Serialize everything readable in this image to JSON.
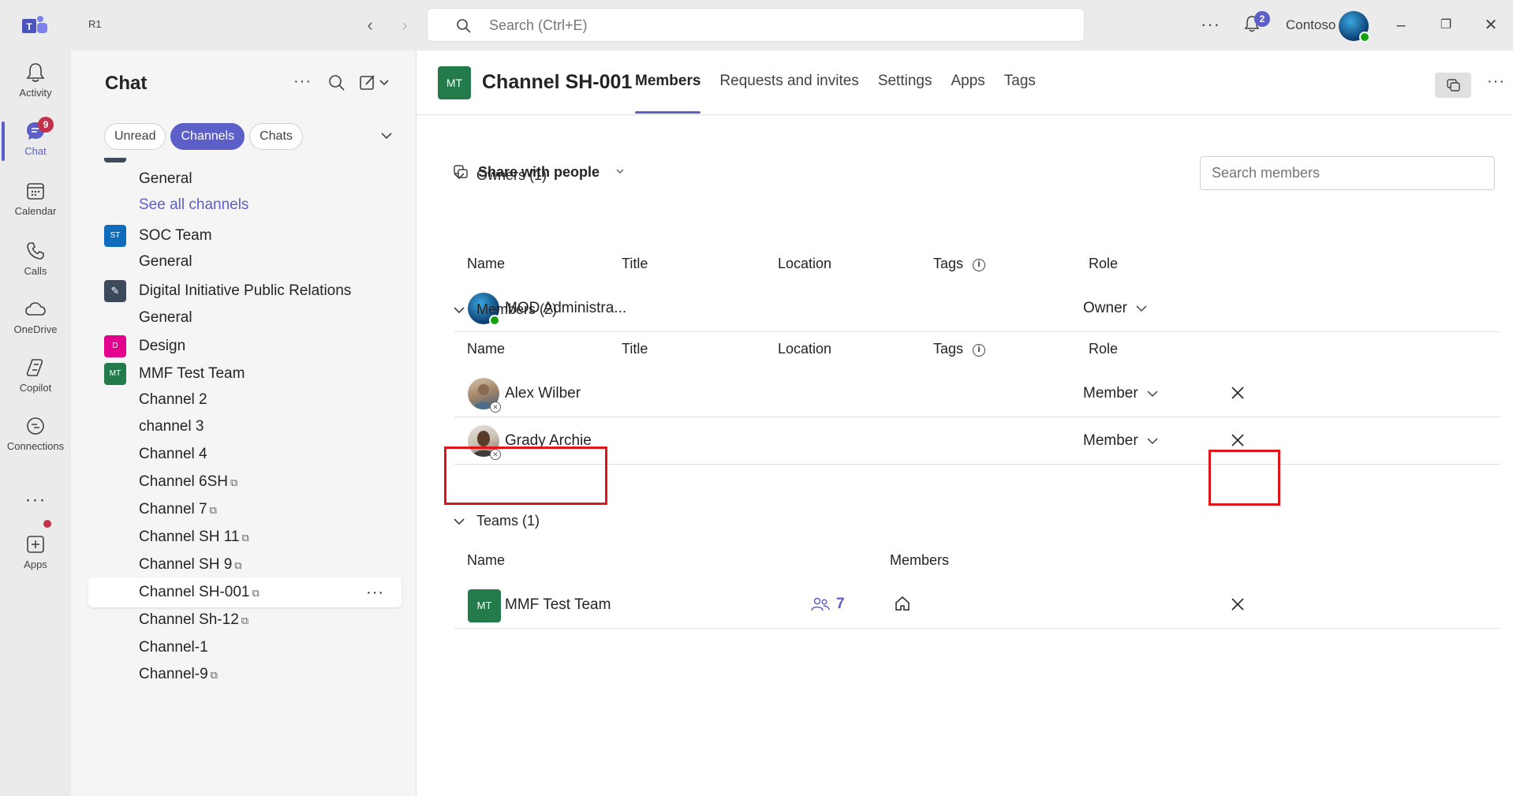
{
  "titlebar": {
    "org_short": "R1",
    "search_placeholder": "Search (Ctrl+E)",
    "notifications_count": "2",
    "org_name": "Contoso"
  },
  "rail": {
    "items": [
      {
        "label": "Activity",
        "icon": "bell-icon"
      },
      {
        "label": "Chat",
        "icon": "chat-icon",
        "badge": "9"
      },
      {
        "label": "Calendar",
        "icon": "calendar-icon"
      },
      {
        "label": "Calls",
        "icon": "phone-icon"
      },
      {
        "label": "OneDrive",
        "icon": "cloud-icon"
      },
      {
        "label": "Copilot",
        "icon": "copilot-icon"
      },
      {
        "label": "Connections",
        "icon": "connections-icon"
      },
      {
        "label": "Apps",
        "icon": "plus-square-icon"
      }
    ]
  },
  "chatpane": {
    "title": "Chat",
    "filters": [
      "Unread",
      "Channels",
      "Chats"
    ],
    "active_filter": "Channels",
    "list": [
      {
        "kind": "channel",
        "name": "General"
      },
      {
        "kind": "link",
        "name": "See all channels"
      },
      {
        "kind": "team",
        "name": "SOC Team",
        "initials": "ST",
        "color": "#0f6cbd"
      },
      {
        "kind": "channel",
        "name": "General"
      },
      {
        "kind": "team",
        "name": "Digital Initiative Public Relations",
        "initials": "✎",
        "color": "#3d4a5c"
      },
      {
        "kind": "channel",
        "name": "General"
      },
      {
        "kind": "team",
        "name": "Design",
        "initials": "D",
        "color": "#e3008c"
      },
      {
        "kind": "team",
        "name": "MMF Test Team",
        "initials": "MT",
        "color": "#237b4b"
      },
      {
        "kind": "channel",
        "name": "Channel 2"
      },
      {
        "kind": "channel",
        "name": "channel 3"
      },
      {
        "kind": "channel",
        "name": "Channel 4"
      },
      {
        "kind": "channel",
        "name": "Channel 6SH",
        "shared": true
      },
      {
        "kind": "channel",
        "name": "Channel 7",
        "shared": true
      },
      {
        "kind": "channel",
        "name": "Channel SH 11",
        "shared": true
      },
      {
        "kind": "channel",
        "name": "Channel SH 9",
        "shared": true
      },
      {
        "kind": "channel",
        "name": "Channel SH-001",
        "shared": true,
        "selected": true
      },
      {
        "kind": "channel",
        "name": "Channel Sh-12",
        "shared": true
      },
      {
        "kind": "channel",
        "name": "Channel-1"
      },
      {
        "kind": "channel",
        "name": "Channel-9",
        "shared": true
      }
    ]
  },
  "main": {
    "channel_initials": "MT",
    "channel_title": "Channel SH-001",
    "tabs": [
      "Members",
      "Requests and invites",
      "Settings",
      "Apps",
      "Tags"
    ],
    "active_tab": "Members",
    "share_label": "Share with people",
    "search_members_placeholder": "Search members",
    "columns": {
      "name": "Name",
      "title": "Title",
      "location": "Location",
      "tags": "Tags",
      "role": "Role",
      "members": "Members"
    },
    "owners": {
      "header": "Owners (1)",
      "rows": [
        {
          "name": "MOD Administra...",
          "role": "Owner"
        }
      ]
    },
    "members": {
      "header": "Members (2)",
      "rows": [
        {
          "name": "Alex Wilber",
          "role": "Member"
        },
        {
          "name": "Grady Archie",
          "role": "Member"
        }
      ]
    },
    "teams": {
      "header": "Teams (1)",
      "rows": [
        {
          "name": "MMF Test Team",
          "initials": "MT",
          "member_count": "7"
        }
      ]
    }
  },
  "colors": {
    "accent": "#5b5fc7",
    "highlight": "#e0141b",
    "team_green": "#237b4b"
  }
}
